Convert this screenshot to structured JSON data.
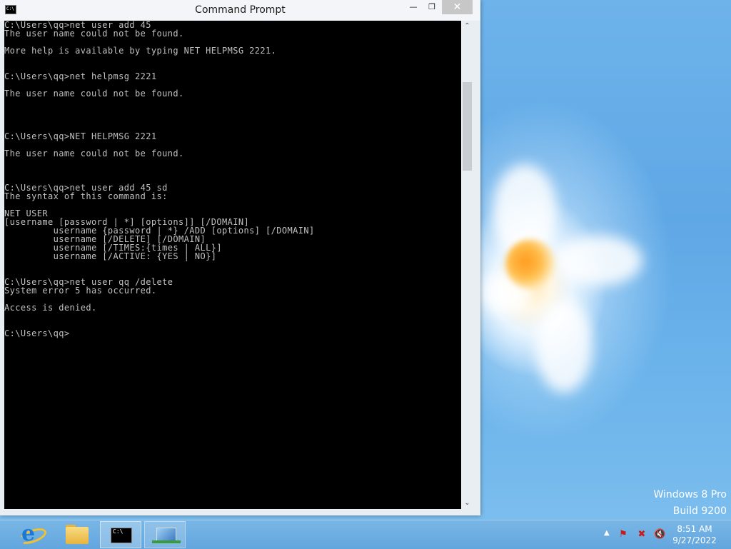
{
  "window": {
    "title": "Command Prompt",
    "icon_text": "C:\\",
    "minimize": "—",
    "maximize": "❐",
    "close": "✕"
  },
  "console": {
    "lines": [
      "C:\\Users\\qq>net user add 45",
      "The user name could not be found.",
      "",
      "More help is available by typing NET HELPMSG 2221.",
      "",
      "",
      "C:\\Users\\qq>net helpmsg 2221",
      "",
      "The user name could not be found.",
      "",
      "",
      "",
      "",
      "C:\\Users\\qq>NET HELPMSG 2221",
      "",
      "The user name could not be found.",
      "",
      "",
      "",
      "C:\\Users\\qq>net user add 45 sd",
      "The syntax of this command is:",
      "",
      "NET USER",
      "[username [password | *] [options]] [/DOMAIN]",
      "         username {password | *} /ADD [options] [/DOMAIN]",
      "         username [/DELETE] [/DOMAIN]",
      "         username [/TIMES:{times | ALL}]",
      "         username [/ACTIVE: {YES | NO}]",
      "",
      "",
      "C:\\Users\\qq>net user qq /delete",
      "System error 5 has occurred.",
      "",
      "Access is denied.",
      "",
      "",
      "C:\\Users\\qq>"
    ]
  },
  "scrollbar": {
    "up": "⌃",
    "down": "⌄"
  },
  "desktop": {
    "watermark_line1": "Windows 8 Pro",
    "watermark_line2": "Build 9200"
  },
  "taskbar": {
    "apps": [
      {
        "name": "internet-explorer",
        "icon": "ie-icon"
      },
      {
        "name": "file-explorer",
        "icon": "folder-icon"
      },
      {
        "name": "command-prompt",
        "icon": "cmd-icon",
        "active": true
      },
      {
        "name": "network-app",
        "icon": "network-icon"
      }
    ],
    "clock_time": "8:51 AM",
    "clock_date": "9/27/2022",
    "tray_expand": "▲"
  }
}
